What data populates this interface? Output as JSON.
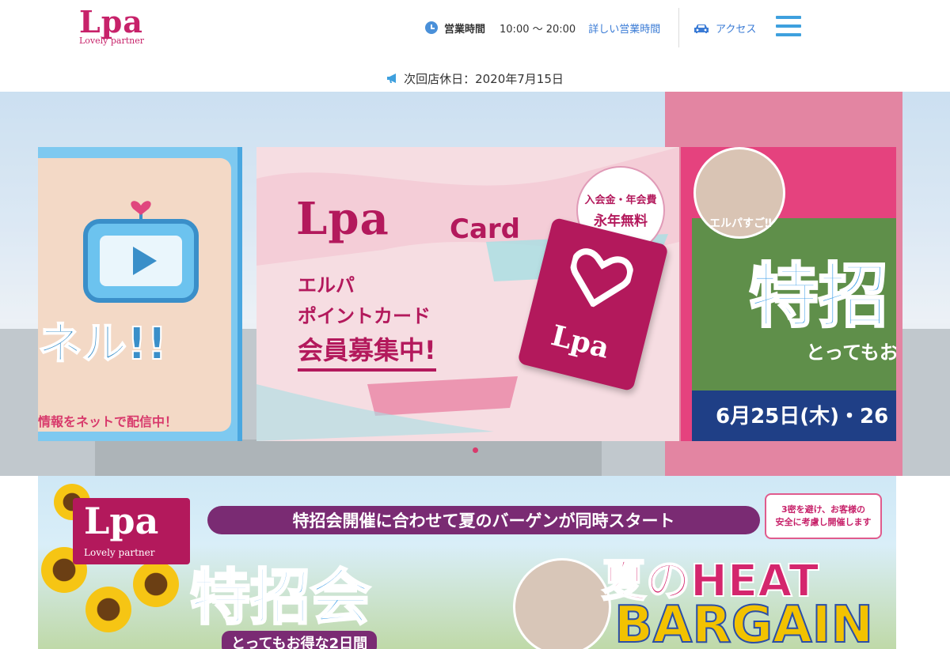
{
  "header": {
    "logo_text": "Lpa",
    "logo_sub": "Lovely partner",
    "hours_label": "営業時間",
    "hours_time": "10:00 〜 20:00",
    "hours_link": "詳しい営業時間",
    "access_label": "アクセス"
  },
  "notice": {
    "text": "次回店休日：2020年7月15日"
  },
  "hero": {
    "left_slide": {
      "bottom_text": "情報をネットで配信中！"
    },
    "center_slide": {
      "logo": "Lpa",
      "card_word": "Card",
      "line1": "エルパ",
      "line2": "ポイントカード",
      "line3": "会員募集中!",
      "badge_line1": "入会金・年会費",
      "badge_line2": "永年無料",
      "card_logo": "Lpa"
    },
    "right_slide": {
      "bubble": "エルパすご‼",
      "title": "特招",
      "sub": "とってもお",
      "date": "6月25日(木)・26"
    },
    "active_slide": 1
  },
  "banner": {
    "logo_text": "Lpa",
    "logo_sub": "Lovely partner",
    "headline": "特招会開催に合わせて夏のバーゲンが同時スタート",
    "note_line1": "3密を避け、お客様の",
    "note_line2": "安全に考慮し開催します",
    "big_title": "特招会",
    "sub": "とってもお得な2日間",
    "heat": "夏のHEAT",
    "bargain": "BARGAIN"
  },
  "colors": {
    "brand": "#c7226a",
    "link": "#3a7bd5",
    "menu": "#3ea0de"
  }
}
